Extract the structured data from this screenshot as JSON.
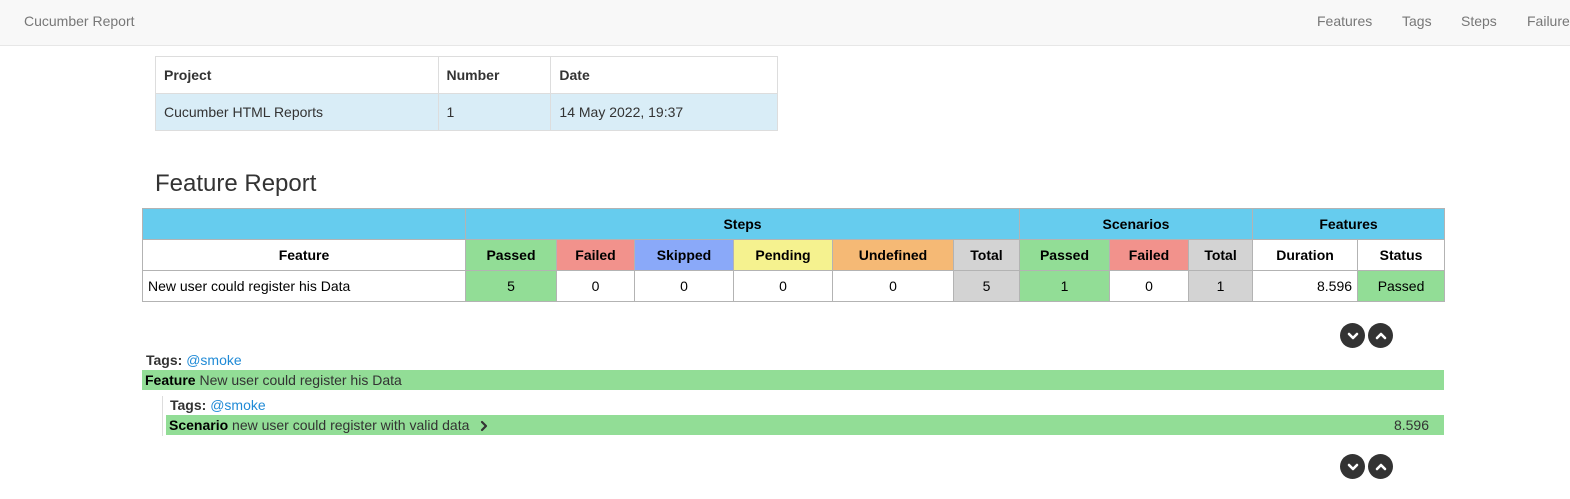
{
  "navbar": {
    "brand": "Cucumber Report",
    "links": [
      "Features",
      "Tags",
      "Steps",
      "Failures"
    ]
  },
  "info_table": {
    "headers": [
      "Project",
      "Number",
      "Date"
    ],
    "row": [
      "Cucumber HTML Reports",
      "1",
      "14 May 2022, 19:37"
    ]
  },
  "feature_report": {
    "title": "Feature Report",
    "group_headers": [
      "Steps",
      "Scenarios",
      "Features"
    ],
    "column_headers": [
      "Feature",
      "Passed",
      "Failed",
      "Skipped",
      "Pending",
      "Undefined",
      "Total",
      "Passed",
      "Failed",
      "Total",
      "Duration",
      "Status"
    ],
    "row": {
      "feature": "New user could register his Data",
      "steps_passed": "5",
      "steps_failed": "0",
      "steps_skipped": "0",
      "steps_pending": "0",
      "steps_undefined": "0",
      "steps_total": "5",
      "scenarios_passed": "1",
      "scenarios_failed": "0",
      "scenarios_total": "1",
      "duration": "8.596",
      "status": "Passed"
    }
  },
  "details": {
    "feature_tags_label": "Tags:",
    "feature_tag": "@smoke",
    "feature_keyword": "Feature",
    "feature_name": "New user could register his Data",
    "scenario_tags_label": "Tags:",
    "scenario_tag": "@smoke",
    "scenario_keyword": "Scenario",
    "scenario_name": "new user could register with valid data",
    "scenario_duration": "8.596"
  },
  "icons": [
    "chevron-circle-down-icon",
    "chevron-circle-up-icon",
    "chevron-right-icon"
  ],
  "colors": {
    "header_blue": "#66ccee",
    "passed": "#92dd96",
    "failed": "#f2928c",
    "skipped": "#8aa9f9",
    "pending": "#f5f28f",
    "undefined": "#f5b975",
    "total": "#d3d3d3",
    "tag_link": "#1f8ad6"
  }
}
